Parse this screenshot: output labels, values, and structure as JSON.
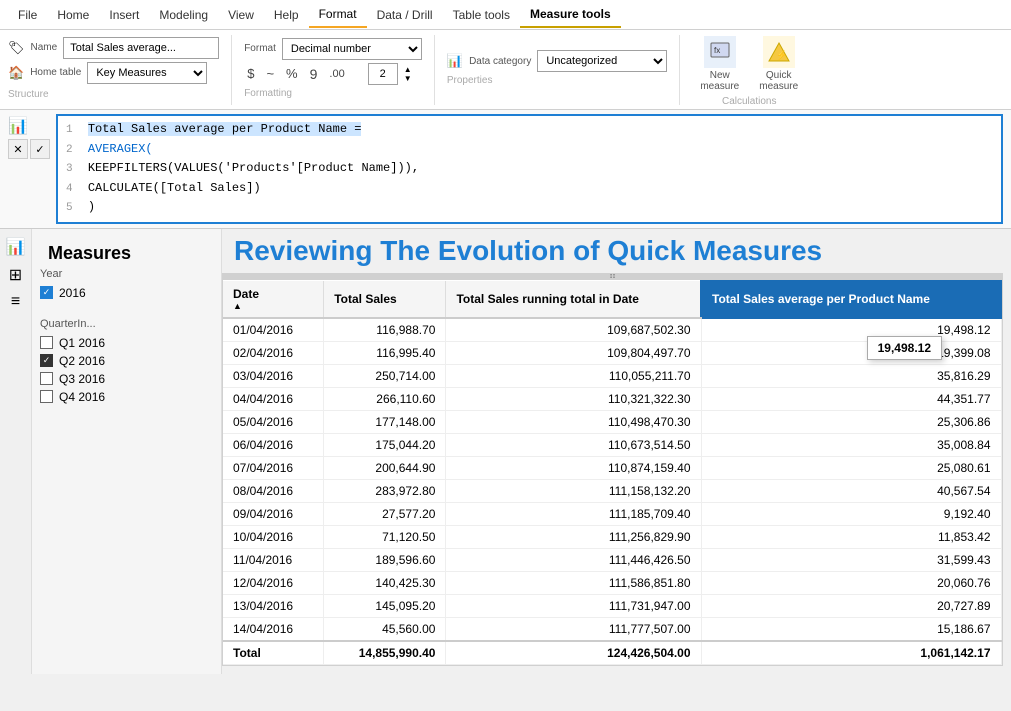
{
  "menubar": {
    "items": [
      {
        "id": "file",
        "label": "File"
      },
      {
        "id": "home",
        "label": "Home"
      },
      {
        "id": "insert",
        "label": "Insert"
      },
      {
        "id": "modeling",
        "label": "Modeling"
      },
      {
        "id": "view",
        "label": "View"
      },
      {
        "id": "help",
        "label": "Help"
      },
      {
        "id": "format",
        "label": "Format",
        "active": true
      },
      {
        "id": "data-drill",
        "label": "Data / Drill"
      },
      {
        "id": "table-tools",
        "label": "Table tools"
      },
      {
        "id": "measure-tools",
        "label": "Measure tools",
        "highlight": true
      }
    ]
  },
  "ribbon": {
    "name_label": "Name",
    "name_value": "Total Sales average...",
    "home_table_label": "Home table",
    "home_table_value": "Key Measures",
    "format_label": "Format",
    "format_value": "Decimal number",
    "data_category_label": "Data category",
    "data_category_value": "Uncategorized",
    "currency_symbol": "$",
    "percent_symbol": "%",
    "comma_symbol": "9",
    "decimal_symbol": ".00",
    "decimal_value": "2",
    "calculations_label": "Calculations",
    "new_measure_label": "New\nmeasure",
    "quick_measure_label": "Quick\nmeasure",
    "structure_label": "Structure",
    "formatting_label": "Formatting",
    "properties_label": "Properties"
  },
  "formula": {
    "line1": "  Total Sales average per Product Name =",
    "line2": "  AVERAGEX(",
    "line3": "    KEEPFILTERS(VALUES('Products'[Product Name])),",
    "line4": "    CALCULATE([Total Sales])",
    "line5": "  )"
  },
  "sidebar": {
    "measures_title": "Measures",
    "year_label": "Year",
    "year_item": "2016",
    "year_checked": true,
    "quarter_label": "QuarterIn...",
    "quarter_items": [
      {
        "label": "Q1 2016",
        "checked": false
      },
      {
        "label": "Q2 2016",
        "checked": true
      },
      {
        "label": "Q3 2016",
        "checked": false
      },
      {
        "label": "Q4 2016",
        "checked": false
      }
    ]
  },
  "heading": "Reviewing The Evolution of Quick Measures",
  "table": {
    "columns": [
      {
        "id": "date",
        "label": "Date"
      },
      {
        "id": "total_sales",
        "label": "Total Sales"
      },
      {
        "id": "running_total",
        "label": "Total Sales running total in Date"
      },
      {
        "id": "avg_per_product",
        "label": "Total Sales average per Product Name",
        "highlighted": true
      }
    ],
    "rows": [
      {
        "date": "01/04/2016",
        "total_sales": "116,988.70",
        "running_total": "109,687,502.30",
        "avg_per_product": "19,498.12"
      },
      {
        "date": "02/04/2016",
        "total_sales": "116,995.40",
        "running_total": "109,804,497.70",
        "avg_per_product": "19,399.08"
      },
      {
        "date": "03/04/2016",
        "total_sales": "250,714.00",
        "running_total": "110,055,211.70",
        "avg_per_product": "35,816.29"
      },
      {
        "date": "04/04/2016",
        "total_sales": "266,110.60",
        "running_total": "110,321,322.30",
        "avg_per_product": "44,351.77"
      },
      {
        "date": "05/04/2016",
        "total_sales": "177,148.00",
        "running_total": "110,498,470.30",
        "avg_per_product": "25,306.86"
      },
      {
        "date": "06/04/2016",
        "total_sales": "175,044.20",
        "running_total": "110,673,514.50",
        "avg_per_product": "35,008.84"
      },
      {
        "date": "07/04/2016",
        "total_sales": "200,644.90",
        "running_total": "110,874,159.40",
        "avg_per_product": "25,080.61"
      },
      {
        "date": "08/04/2016",
        "total_sales": "283,972.80",
        "running_total": "111,158,132.20",
        "avg_per_product": "40,567.54"
      },
      {
        "date": "09/04/2016",
        "total_sales": "27,577.20",
        "running_total": "111,185,709.40",
        "avg_per_product": "9,192.40"
      },
      {
        "date": "10/04/2016",
        "total_sales": "71,120.50",
        "running_total": "111,256,829.90",
        "avg_per_product": "11,853.42"
      },
      {
        "date": "11/04/2016",
        "total_sales": "189,596.60",
        "running_total": "111,446,426.50",
        "avg_per_product": "31,599.43"
      },
      {
        "date": "12/04/2016",
        "total_sales": "140,425.30",
        "running_total": "111,586,851.80",
        "avg_per_product": "20,060.76"
      },
      {
        "date": "13/04/2016",
        "total_sales": "145,095.20",
        "running_total": "111,731,947.00",
        "avg_per_product": "20,727.89"
      },
      {
        "date": "14/04/2016",
        "total_sales": "45,560.00",
        "running_total": "111,777,507.00",
        "avg_per_product": "15,186.67"
      }
    ],
    "total_row": {
      "label": "Total",
      "total_sales": "14,855,990.40",
      "running_total": "124,426,504.00",
      "avg_per_product": "1,061,142.17"
    },
    "tooltip_value": "19,498.12"
  }
}
